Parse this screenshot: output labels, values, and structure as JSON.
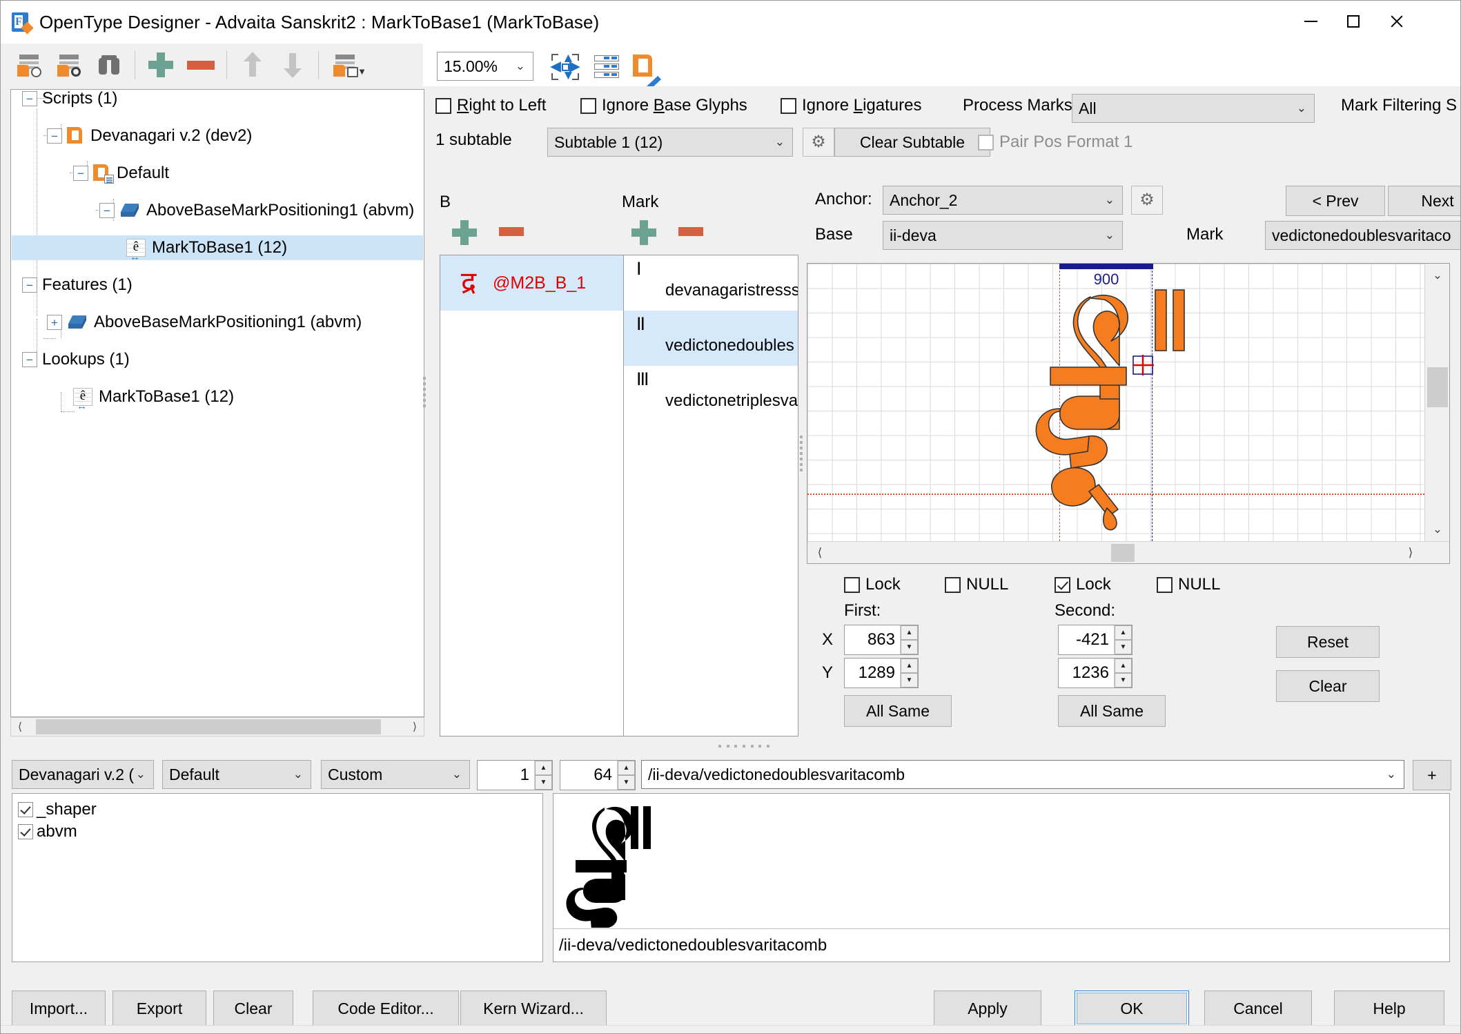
{
  "window": {
    "title": "OpenType Designer - Advaita Sanskrit2 : MarkToBase1 (MarkToBase)",
    "minimize_label": "—",
    "maximize_label": "□",
    "close_label": "✕"
  },
  "toolbar": {
    "icons": [
      "run-lookup-icon",
      "inspect-lookup-icon",
      "find-icon",
      "add-icon",
      "remove-icon",
      "move-up-icon",
      "move-down-icon",
      "lookup-options-icon"
    ],
    "settings_icon": "gear-icon",
    "zoom_value": "15.00%",
    "fit_icon": "fit-to-window-icon",
    "table_icon": "table-view-icon",
    "edit_icon": "edit-glyph-icon"
  },
  "options": {
    "right_to_left": {
      "label": "Right to Left",
      "checked": false
    },
    "ignore_base_glyphs": {
      "label": "Ignore Base Glyphs",
      "checked": false
    },
    "ignore_ligatures": {
      "label": "Ignore Ligatures",
      "checked": false
    },
    "process_marks_label": "Process Marks:",
    "process_marks_value": "All",
    "mark_filtering_label": "Mark Filtering S",
    "subtable_count": "1 subtable",
    "subtable_value": "Subtable 1 (12)",
    "clear_subtable_label": "Clear Subtable",
    "pair_pos_format_1": {
      "label": "Pair Pos Format 1",
      "checked": false,
      "disabled": true
    }
  },
  "tree": {
    "nodes": [
      {
        "label": "Scripts (1)",
        "expander": "−",
        "icon": null,
        "depth": 0,
        "selected": false
      },
      {
        "label": "Devanagari v.2 (dev2)",
        "expander": "−",
        "icon": "script-icon",
        "depth": 1,
        "selected": false
      },
      {
        "label": "Default",
        "expander": "−",
        "icon": "langsys-icon",
        "depth": 2,
        "selected": false
      },
      {
        "label": "AboveBaseMarkPositioning1 (abvm)",
        "expander": "−",
        "icon": "feature-icon",
        "depth": 3,
        "selected": false
      },
      {
        "label": "MarkToBase1 (12)",
        "expander": null,
        "icon": "lookup-icon",
        "depth": 4,
        "selected": true
      },
      {
        "label": "Features (1)",
        "expander": "−",
        "icon": null,
        "depth": 0,
        "selected": false
      },
      {
        "label": "AboveBaseMarkPositioning1 (abvm)",
        "expander": "+",
        "icon": "feature-icon",
        "depth": 1,
        "selected": false
      },
      {
        "label": "Lookups (1)",
        "expander": "−",
        "icon": null,
        "depth": 0,
        "selected": false
      },
      {
        "label": "MarkToBase1 (12)",
        "expander": null,
        "icon": "lookup-icon",
        "depth": 1,
        "selected": false
      }
    ]
  },
  "panels": {
    "b_label": "B",
    "mark_label": "Mark",
    "b_add_icon": "add-icon",
    "b_remove_icon": "remove-icon",
    "mark_add_icon": "add-icon",
    "mark_remove_icon": "remove-icon",
    "b_rows": [
      {
        "glyph": "द्र",
        "name": "@M2B_B_1",
        "selected": true
      }
    ],
    "mark_rows": [
      {
        "marker": "I",
        "name": "devanagaristresss",
        "selected": false
      },
      {
        "marker": "II",
        "name": "vedictonedoubles",
        "selected": true
      },
      {
        "marker": "III",
        "name": "vedictonetriplesva",
        "selected": false
      }
    ]
  },
  "anchor": {
    "anchor_label": "Anchor:",
    "anchor_value": "Anchor_2",
    "anchor_settings_icon": "gear-icon",
    "base_label": "Base",
    "base_value": "ii-deva",
    "mark_label": "Mark",
    "mark_value": "vedictonedoublesvaritaco",
    "prev_label": "< Prev",
    "next_label": "Next"
  },
  "canvas": {
    "advance_width": "900",
    "glyph": "द्र",
    "scroll_left_icon": "chevron-left-icon",
    "scroll_right_icon": "chevron-right-icon",
    "scroll_up_icon": "chevron-up-icon",
    "scroll_down_icon": "chevron-down-icon"
  },
  "coords": {
    "lock_first": {
      "label": "Lock",
      "checked": false
    },
    "null_first": {
      "label": "NULL",
      "checked": false
    },
    "lock_second": {
      "label": "Lock",
      "checked": true
    },
    "null_second": {
      "label": "NULL",
      "checked": false
    },
    "first_label": "First:",
    "second_label": "Second:",
    "x_label": "X",
    "y_label": "Y",
    "first_x": "863",
    "first_y": "1289",
    "second_x": "-421",
    "second_y": "1236",
    "all_same_first": "All Same",
    "all_same_second": "All Same",
    "reset_label": "Reset",
    "clear_label": "Clear"
  },
  "preview_bar": {
    "script": "Devanagari v.2 (",
    "language": "Default",
    "mode": "Custom",
    "count": "1",
    "size": "64",
    "glyph_string": "/ii-deva/vedictonedoublesvaritacomb",
    "add_label": "+",
    "features": [
      {
        "label": "_shaper",
        "checked": true
      },
      {
        "label": "abvm",
        "checked": true
      }
    ],
    "preview_glyph": "द्र",
    "status_text": "/ii-deva/vedictonedoublesvaritacomb"
  },
  "footer": {
    "buttons_left": [
      {
        "label": "Import...",
        "focus": false
      },
      {
        "label": "Export",
        "focus": false
      },
      {
        "label": "Clear",
        "focus": false
      },
      {
        "label": "Code Editor...",
        "focus": false
      },
      {
        "label": "Kern Wizard...",
        "focus": false
      }
    ],
    "buttons_right": [
      {
        "label": "Apply",
        "focus": false
      },
      {
        "label": "OK",
        "focus": true
      },
      {
        "label": "Cancel",
        "focus": false
      },
      {
        "label": "Help",
        "focus": false
      }
    ]
  },
  "colors": {
    "accent_orange": "#f57c1f",
    "selection_blue": "#cce4f7",
    "add_green": "#6ba292",
    "remove_red": "#d4603f",
    "glyph_red": "#e10000",
    "advance_navy": "#1a1a8c",
    "baseline_red": "#e04a2a"
  }
}
